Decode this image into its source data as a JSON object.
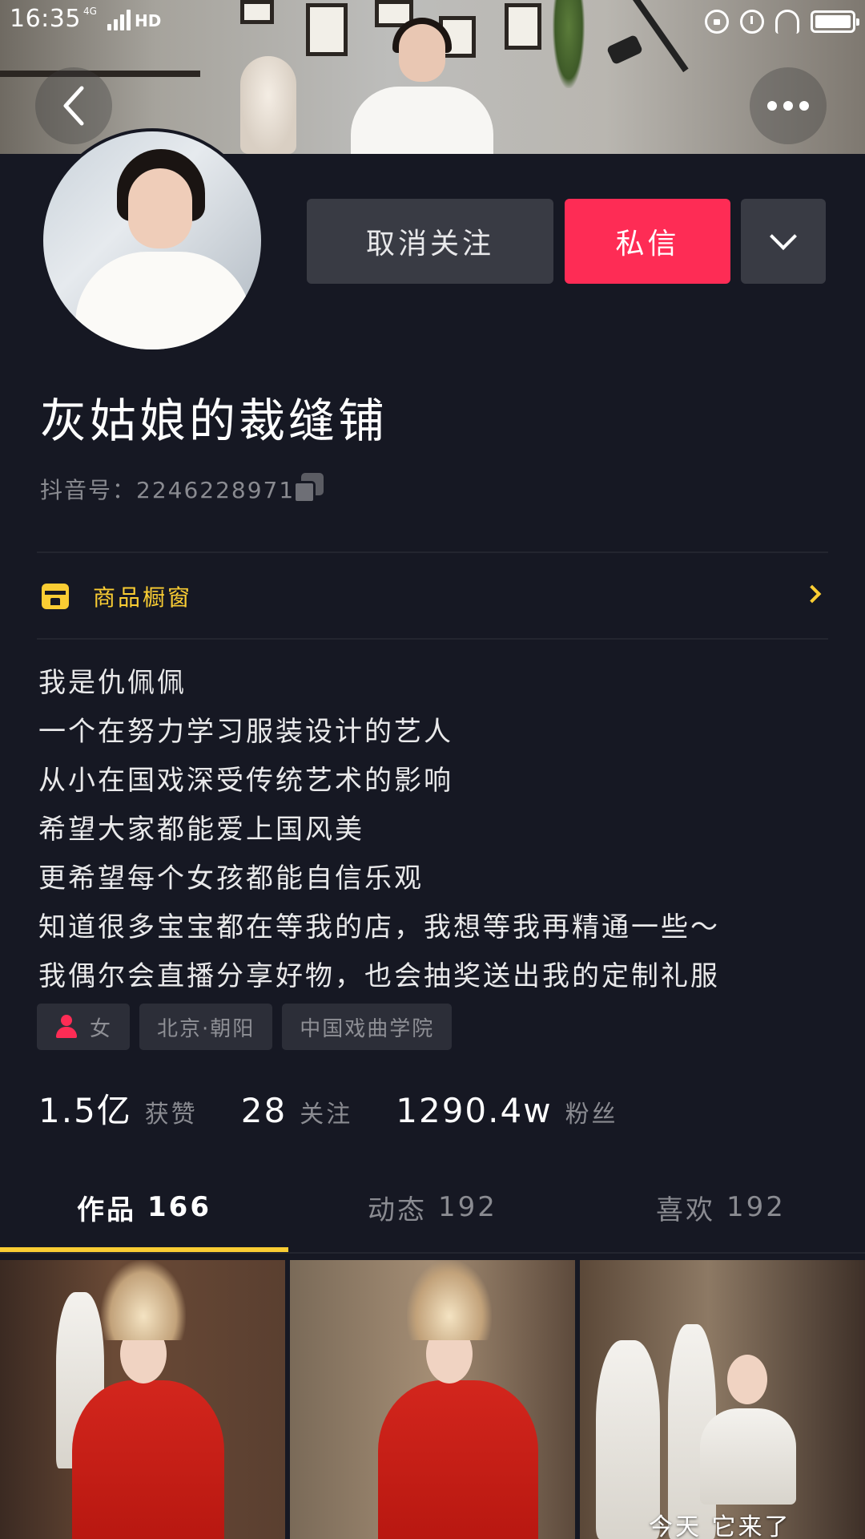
{
  "status_bar": {
    "time": "16:35",
    "network": "4G",
    "hd": "HD",
    "icons": [
      "lock-rotation-icon",
      "alarm-icon",
      "headset-icon",
      "battery-icon"
    ]
  },
  "header": {
    "back_icon": "chevron-left-icon",
    "more_icon": "more-dots-icon"
  },
  "profile": {
    "unfollow_label": "取消关注",
    "message_label": "私信",
    "dropdown_icon": "chevron-down-icon",
    "name": "灰姑娘的裁缝铺",
    "douyin_id": "抖音号：2246228971",
    "copy_icon": "copy-icon"
  },
  "shop": {
    "label": "商品橱窗",
    "icon": "shop-icon",
    "arrow_icon": "chevron-right-icon"
  },
  "bio": [
    "我是仇佩佩",
    "一个在努力学习服装设计的艺人",
    "从小在国戏深受传统艺术的影响",
    "希望大家都能爱上国风美",
    "更希望每个女孩都能自信乐观",
    "知道很多宝宝都在等我的店，我想等我再精通一些～",
    "我偶尔会直播分享好物，也会抽奖送出我的定制礼服"
  ],
  "tags": {
    "gender": "女",
    "location": "北京·朝阳",
    "school": "中国戏曲学院"
  },
  "stats": {
    "likes_num": "1.5亿",
    "likes_label": "获赞",
    "following_num": "28",
    "following_label": "关注",
    "fans_num": "1290.4w",
    "fans_label": "粉丝"
  },
  "tabs": [
    {
      "label": "作品",
      "count": "166",
      "active": true
    },
    {
      "label": "动态",
      "count": "192",
      "active": false
    },
    {
      "label": "喜欢",
      "count": "192",
      "active": false
    }
  ],
  "videos": [
    {
      "caption": ""
    },
    {
      "caption": ""
    },
    {
      "caption": "今天 它来了"
    }
  ],
  "colors": {
    "background": "#161823",
    "accent_red": "#fe2c55",
    "accent_yellow": "#facd33",
    "button_gray": "#393b44",
    "muted_text": "#8a8b91"
  }
}
